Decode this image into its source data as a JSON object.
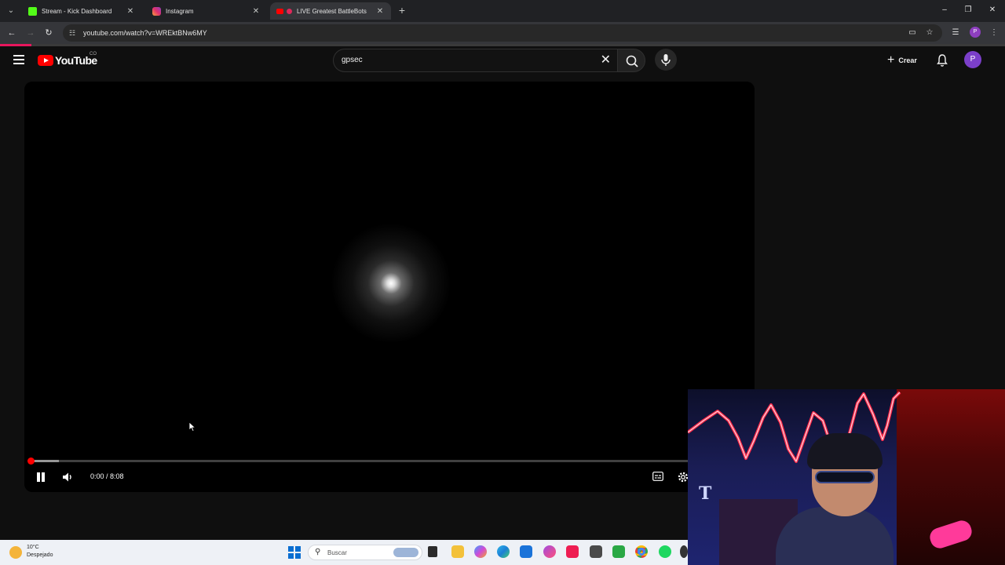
{
  "browser": {
    "tabs": [
      {
        "title": "Stream - Kick Dashboard",
        "favicon_color": "#53fc18",
        "active": false
      },
      {
        "title": "Instagram",
        "favicon_color": "#e1306c",
        "active": false
      },
      {
        "title": "LIVE Greatest BattleBots",
        "favicon_color": "#ff0000",
        "active": true
      }
    ],
    "url": "youtube.com/watch?v=WREktBNw6MY",
    "profile_initial": "P",
    "page_loading": true
  },
  "youtube": {
    "logo_word": "YouTube",
    "country_code": "CO",
    "search_query": "gpsec",
    "create_label": "Crear",
    "avatar_initial": "P"
  },
  "player": {
    "time_display": "0:00 / 8:08",
    "current_time_seconds": 0,
    "duration_seconds": 488,
    "playing": true,
    "played_fraction": 0.0,
    "buffered_fraction": 0.04
  },
  "taskbar": {
    "weather_temp": "10°C",
    "weather_desc": "Despejado",
    "search_placeholder": "Buscar",
    "apps": [
      "task-view",
      "file-explorer",
      "copilot",
      "edge",
      "store",
      "messenger",
      "tiktok",
      "game",
      "xbox",
      "chrome",
      "spotify",
      "obs"
    ]
  },
  "colors": {
    "accent_red": "#ff0000",
    "loading_pink": "#e8175d",
    "avatar_purple": "#7b3fc9"
  }
}
